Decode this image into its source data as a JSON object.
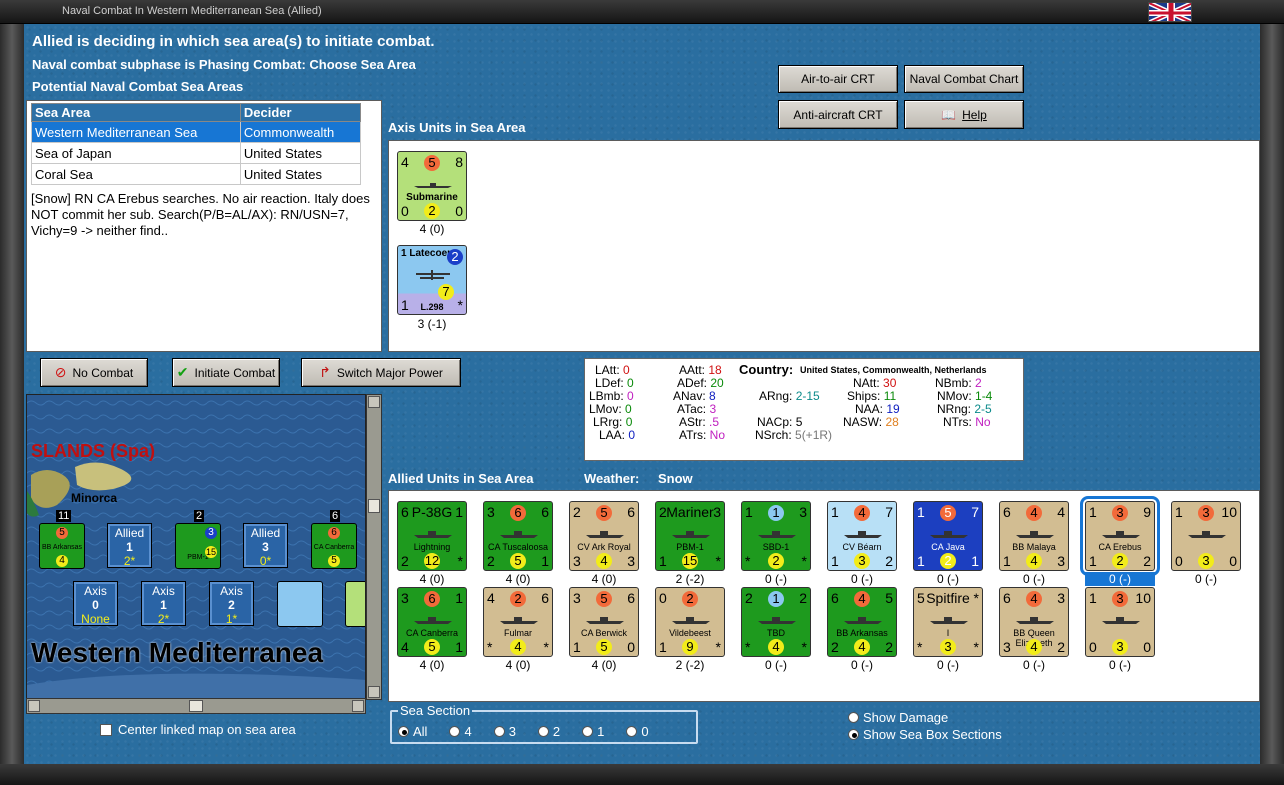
{
  "window": {
    "title": "Naval Combat In Western Mediterranean Sea (Allied)"
  },
  "header": {
    "line1": "Allied is deciding in which sea area(s) to initiate combat.",
    "line2": "Naval combat subphase is Phasing Combat: Choose Sea Area",
    "line3": "Potential Naval Combat Sea Areas"
  },
  "buttons": {
    "air_crt": "Air-to-air CRT",
    "naval_chart": "Naval Combat Chart",
    "aa_crt": "Anti-aircraft CRT",
    "help": "Help",
    "no_combat": "No Combat",
    "initiate": "Initiate Combat",
    "switch": "Switch Major Power"
  },
  "sea_table": {
    "headers": [
      "Sea Area",
      "Decider"
    ],
    "rows": [
      [
        "Western Mediterranean Sea",
        "Commonwealth"
      ],
      [
        "Sea of Japan",
        "United States"
      ],
      [
        "Coral Sea",
        "United States"
      ]
    ]
  },
  "log": "[Snow]  RN CA Erebus searches.  No air reaction. Italy does NOT commit her sub.  Search(P/B=AL/AX):  RN/USN=7, Vichy=9 -> neither find..",
  "axis_title": "Axis Units in Sea Area",
  "axis_units": [
    {
      "tl": "4",
      "tm": "5",
      "tr": "8",
      "name": "Submarine",
      "bl": "0",
      "bm": "2",
      "br": "0",
      "label": "4 (0)"
    },
    {
      "tl": "1",
      "tm": "Latecoere",
      "tr": "2",
      "name": "L.298",
      "bl": "1",
      "bm": "7",
      "br": "*",
      "label": "3 (-1)"
    }
  ],
  "stats": {
    "LAtt": "0",
    "LDef": "0",
    "LBmb": "0",
    "LMov": "0",
    "LRrg": "0",
    "LAA": "0",
    "AAtt": "18",
    "ADef": "20",
    "ANav": "8",
    "ATac": "3",
    "AStr": ".5",
    "ATrs": "No",
    "country_label": "Country:",
    "country": "United States, Commonwealth, Netherlands",
    "ARng": "2-15",
    "NACp": "5",
    "NSrch": "5(+1R)",
    "NAtt": "30",
    "Ships": "11",
    "NAA": "19",
    "NASW": "28",
    "NBmb": "2",
    "NMov": "1-4",
    "NRng": "2-5",
    "NTrs": "No"
  },
  "allied_title": "Allied Units in Sea Area",
  "weather_label": "Weather:",
  "weather": "Snow",
  "allied_units_row1": [
    {
      "tl": "6",
      "tm": "P-38G",
      "tr": "1",
      "name": "Lightning",
      "bl": "2",
      "bm": "12",
      "br": "*",
      "label": "4 (0)",
      "color": "gr"
    },
    {
      "tl": "3",
      "tm": "6",
      "tr": "6",
      "name": "CA Tuscaloosa",
      "bl": "2",
      "bm": "5",
      "br": "1",
      "label": "4 (0)",
      "color": "gr"
    },
    {
      "tl": "2",
      "tm": "5",
      "tr": "6",
      "name": "CV Ark Royal",
      "bl": "3",
      "bm": "4",
      "br": "3",
      "label": "4 (0)",
      "color": "tan"
    },
    {
      "tl": "2",
      "tm": "Mariner",
      "tr": "3",
      "name": "PBM-1",
      "bl": "1",
      "bm": "15",
      "br": "*",
      "label": "2 (-2)",
      "color": "gr"
    },
    {
      "tl": "1",
      "tm": "1",
      "tr": "3",
      "name": "SBD-1",
      "bl": "*",
      "bm": "2",
      "br": "*",
      "label": "0 (-)",
      "color": "gr"
    },
    {
      "tl": "1",
      "tm": "4",
      "tr": "7",
      "name": "CV Béarn",
      "bl": "1",
      "bm": "3",
      "br": "2",
      "label": "0 (-)",
      "color": "ltblue"
    },
    {
      "tl": "1",
      "tm": "5",
      "tr": "7",
      "name": "CA Java",
      "bl": "1",
      "bm": "2",
      "br": "1",
      "label": "0 (-)",
      "color": "blue"
    },
    {
      "tl": "6",
      "tm": "4",
      "tr": "4",
      "name": "BB Malaya",
      "bl": "1",
      "bm": "4",
      "br": "3",
      "label": "0 (-)",
      "color": "tan"
    },
    {
      "tl": "1",
      "tm": "3",
      "tr": "9",
      "name": "CA Erebus",
      "bl": "1",
      "bm": "2",
      "br": "2",
      "label": "0 (-)",
      "color": "tan"
    },
    {
      "tl": "1",
      "tm": "3",
      "tr": "10",
      "name": "",
      "bl": "0",
      "bm": "3",
      "br": "0",
      "label": "0 (-)",
      "color": "tan"
    }
  ],
  "allied_units_row2": [
    {
      "tl": "3",
      "tm": "6",
      "tr": "1",
      "name": "CA Canberra",
      "bl": "4",
      "bm": "5",
      "br": "1",
      "label": "4 (0)",
      "color": "gr"
    },
    {
      "tl": "4",
      "tm": "2",
      "tr": "6",
      "name": "Fulmar",
      "bl": "*",
      "bm": "4",
      "br": "*",
      "label": "4 (0)",
      "color": "tan"
    },
    {
      "tl": "3",
      "tm": "5",
      "tr": "6",
      "name": "CA Berwick",
      "bl": "1",
      "bm": "5",
      "br": "0",
      "label": "4 (0)",
      "color": "tan"
    },
    {
      "tl": "0",
      "tm": "2",
      "tr": "",
      "name": "Vildebeest",
      "bl": "1",
      "bm": "9",
      "br": "*",
      "label": "2 (-2)",
      "color": "tan"
    },
    {
      "tl": "2",
      "tm": "1",
      "tr": "2",
      "name": "TBD",
      "bl": "*",
      "bm": "4",
      "br": "*",
      "label": "0 (-)",
      "color": "gr"
    },
    {
      "tl": "6",
      "tm": "4",
      "tr": "5",
      "name": "BB Arkansas",
      "bl": "2",
      "bm": "4",
      "br": "2",
      "label": "0 (-)",
      "color": "gr"
    },
    {
      "tl": "5",
      "tm": "Spitfire",
      "tr": "*",
      "name": "I",
      "bl": "*",
      "bm": "3",
      "br": "*",
      "label": "0 (-)",
      "color": "tan"
    },
    {
      "tl": "6",
      "tm": "4",
      "tr": "3",
      "name": "BB Queen Elizabeth",
      "bl": "3",
      "bm": "4",
      "br": "2",
      "label": "0 (-)",
      "color": "tan"
    },
    {
      "tl": "1",
      "tm": "3",
      "tr": "10",
      "name": "",
      "bl": "0",
      "bm": "3",
      "br": "0",
      "label": "0 (-)",
      "color": "tan"
    }
  ],
  "map": {
    "title": "SLANDS (Spa)",
    "island": "Minorca",
    "sea_name": "Western Mediterranea",
    "allied_boxes": [
      {
        "h": "Allied",
        "n": "1",
        "v": "2*"
      },
      {
        "h": "Allied",
        "n": "3",
        "v": "0*"
      }
    ],
    "axis_boxes": [
      {
        "h": "Axis",
        "n": "0",
        "v": "None"
      },
      {
        "h": "Axis",
        "n": "1",
        "v": "2*"
      },
      {
        "h": "Axis",
        "n": "2",
        "v": "1*"
      }
    ],
    "counters": [
      {
        "top": "11",
        "name": "BB Arkansas",
        "a": "5",
        "b": "4"
      },
      {
        "top": "2",
        "name": "PBM-1",
        "a": "3",
        "b": "15"
      },
      {
        "top": "6",
        "name": "CA Canberra",
        "a": "6",
        "b": "5"
      }
    ]
  },
  "center_map": "Center linked map on sea area",
  "sea_section": {
    "label": "Sea Section",
    "options": [
      "All",
      "4",
      "3",
      "2",
      "1",
      "0"
    ]
  },
  "display": {
    "show_damage": "Show Damage",
    "show_sections": "Show Sea Box Sections"
  }
}
